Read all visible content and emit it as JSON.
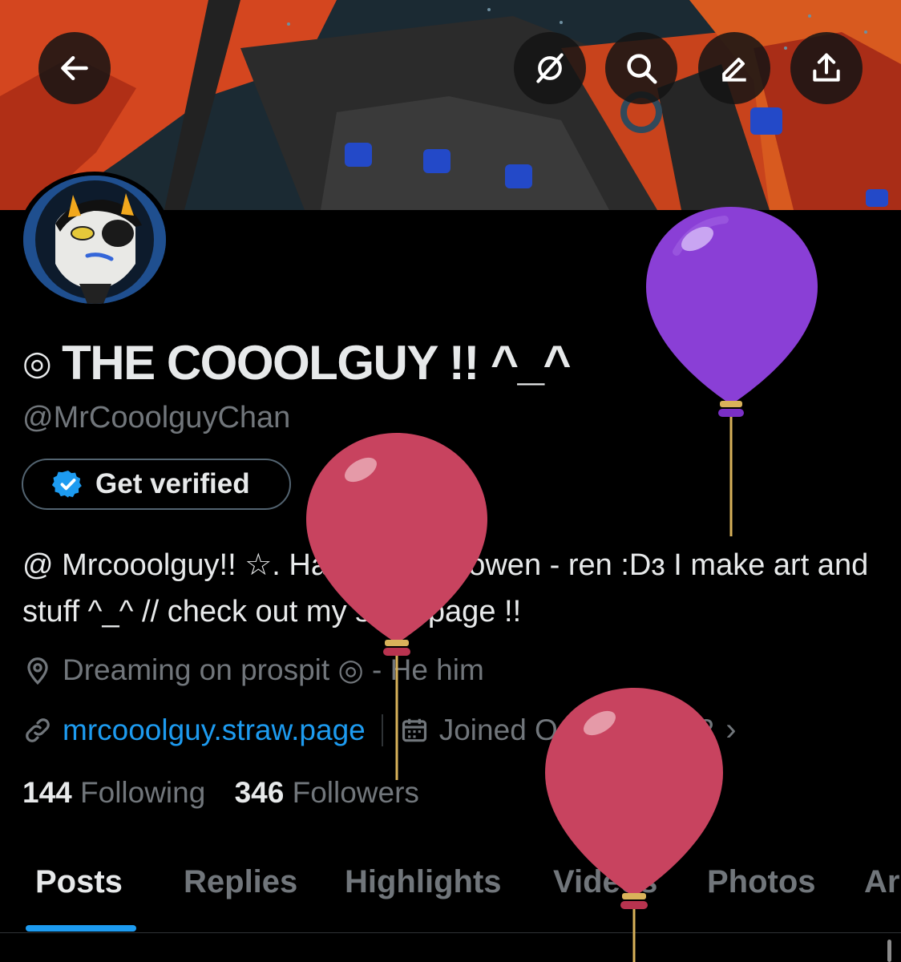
{
  "profile": {
    "name_prefix": "◎",
    "name": "THE COOOLGUY !! ^_^",
    "handle": "@MrCooolguyChan",
    "get_verified": "Get verified",
    "bio": "@ Mrcooolguy!! ☆. Haii haii im Rowen - ren :Dɜ I make art and stuff ^_^ // check out my strawpage !!",
    "location": "Dreaming on prospit ◎ - He him",
    "website": "mrcooolguy.straw.page",
    "joined": "Joined October 2022",
    "chevron": "›",
    "following_count": "144",
    "following_label": "Following",
    "followers_count": "346",
    "followers_label": "Followers"
  },
  "tabs": [
    {
      "label": "Posts",
      "active": true
    },
    {
      "label": "Replies"
    },
    {
      "label": "Highlights"
    },
    {
      "label": "Videos"
    },
    {
      "label": "Photos"
    },
    {
      "label": "Ar"
    }
  ],
  "icons": {
    "back": "back-arrow-icon",
    "grok": "grok-icon",
    "search": "search-icon",
    "edit": "edit-icon",
    "share": "share-icon",
    "verified": "verified-badge-icon",
    "location": "location-pin-icon",
    "link": "link-icon",
    "calendar": "calendar-icon"
  },
  "colors": {
    "background": "#000000",
    "accent": "#1d9bf0",
    "muted": "#71767b",
    "text": "#e7e9ea",
    "balloon_purple": "#8a3fd6",
    "balloon_red": "#c8435f"
  }
}
